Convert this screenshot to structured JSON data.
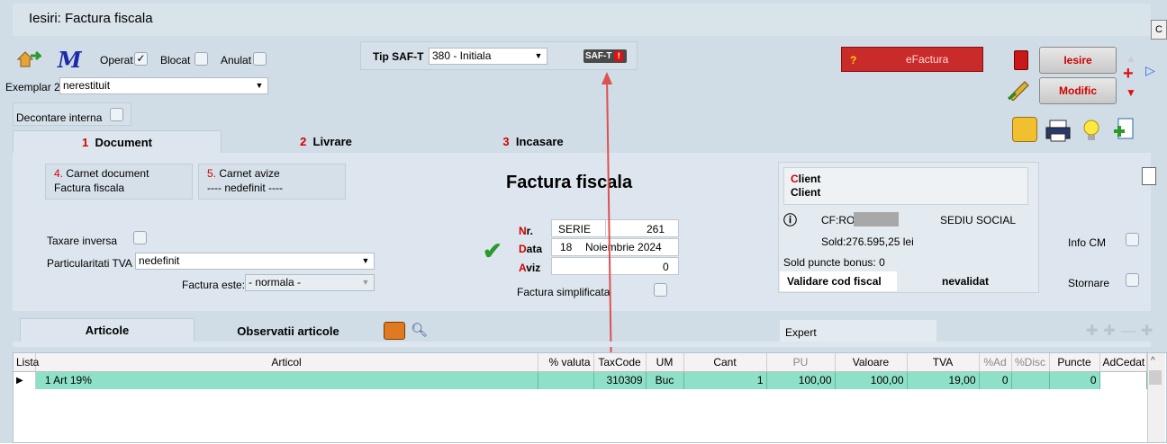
{
  "window": {
    "title": "Iesiri: Factura fiscala",
    "corner_label": "C"
  },
  "toolbar": {
    "operat_label": "Operat",
    "operat_checked": true,
    "blocat_label": "Blocat",
    "anulat_label": "Anulat",
    "exemplar_label": "Exemplar 2:",
    "exemplar_value": "nerestituit",
    "decontare_label": "Decontare interna",
    "saft_label": "Tip SAF-T",
    "saft_value": "380 - Initiala",
    "saft_badge": "SAF-T",
    "efactura_question": "?",
    "efactura_label": "eFactura",
    "iesire_label": "Iesire",
    "modific_label": "Modific"
  },
  "tabs": [
    {
      "num": "1",
      "label": "Document"
    },
    {
      "num": "2",
      "label": "Livrare"
    },
    {
      "num": "3",
      "label": "Incasare"
    }
  ],
  "document": {
    "carnet_doc_label": "4. Carnet document",
    "carnet_doc_value": "Factura fiscala",
    "carnet_avize_label": "5. Carnet avize",
    "carnet_avize_value": "---- nedefinit ----",
    "heading": "Factura fiscala",
    "nr_label_first": "N",
    "nr_label_rest": "r.",
    "serie": "SERIE",
    "nr_value": "261",
    "data_label_first": "D",
    "data_label_rest": "ata",
    "data_day": "18",
    "data_month_year": "Noiembrie 2024",
    "aviz_label_first": "A",
    "aviz_label_rest": "viz",
    "aviz_value": "0",
    "simplificata_label": "Factura simplificata",
    "taxare_label": "Taxare inversa",
    "particularitati_label": "Particularitati TVA",
    "particularitati_value": "nedefinit",
    "factura_este_label": "Factura este:",
    "factura_este_value": "- normala -"
  },
  "client": {
    "line1_first": "C",
    "line1_rest": "lient",
    "line2": "Client",
    "cf_label": "CF:RO",
    "sediu": "SEDIU SOCIAL",
    "sold": "Sold:276.595,25 lei",
    "sold_bonus": "Sold puncte bonus:  0",
    "validare_label": "Validare cod fiscal",
    "validare_status": "nevalidat",
    "info_cm": "Info CM",
    "stornare": "Stornare"
  },
  "bottom_tabs": {
    "articole": "Articole",
    "observatii": "Observatii articole",
    "expert": "Expert"
  },
  "grid": {
    "columns": [
      "Lista",
      "Articol",
      "% valuta",
      "TaxCode",
      "UM",
      "Cant",
      "PU",
      "Valoare",
      "TVA",
      "%Ad",
      "%Disc",
      "Puncte",
      "AdCedat"
    ],
    "rows": [
      {
        "lista": "1",
        "articol": "Art 19%",
        "valuta": "",
        "taxcode": "310309",
        "um": "Buc",
        "cant": "1",
        "pu": "100,00",
        "valoare": "100,00",
        "tva": "19,00",
        "ad": "0",
        "disc": "",
        "puncte": "0",
        "adcedat": ""
      }
    ]
  },
  "colors": {
    "accent_red": "#c92a2a",
    "row_green": "#8fe0c8",
    "window_bg": "#d0dce6"
  }
}
